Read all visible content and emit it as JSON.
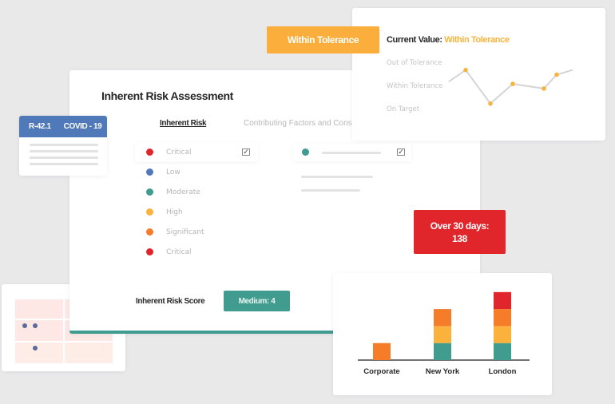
{
  "main": {
    "title": "Inherent Risk Assessment",
    "tabs": [
      {
        "label": "Inherent Risk",
        "active": true
      },
      {
        "label": "Contributing Factors and Cons",
        "active": false
      }
    ],
    "risk_levels": [
      {
        "label": "Critical",
        "color": "#e0262a",
        "checked": true
      },
      {
        "label": "Low",
        "color": "#4f79b8",
        "checked": false
      },
      {
        "label": "Moderate",
        "color": "#3f9c8f",
        "checked": false
      },
      {
        "label": "High",
        "color": "#fbb23c",
        "checked": false
      },
      {
        "label": "Significant",
        "color": "#f57c28",
        "checked": false
      },
      {
        "label": "Critical",
        "color": "#e0262a",
        "checked": false
      }
    ],
    "check_glyph": "✓",
    "score_label": "Inherent Risk Score",
    "score_value": "Medium: 4"
  },
  "covid_tag": {
    "id": "R-42.1",
    "name": "COVID - 19"
  },
  "tolerance_badge": "Within Tolerance",
  "tolerance_chart": {
    "title_prefix": "Current Value:",
    "title_value": "Within Tolerance",
    "levels": [
      "Out of Tolerance",
      "Within Tolerance",
      "On Target"
    ],
    "accent_color": "#f7b33c",
    "line_color": "#d5d5d5"
  },
  "overdue_badge": {
    "line1": "Over 30 days:",
    "line2": "138"
  },
  "chart_data": {
    "type": "bar",
    "stacked": true,
    "categories": [
      "Corporate",
      "New York",
      "London"
    ],
    "series": [
      {
        "name": "Moderate",
        "color": "#3f9c8f",
        "values": [
          0,
          1,
          1
        ]
      },
      {
        "name": "High",
        "color": "#fbb23c",
        "values": [
          0,
          1,
          1
        ]
      },
      {
        "name": "Significant",
        "color": "#f57c28",
        "values": [
          1,
          1,
          1
        ]
      },
      {
        "name": "Critical",
        "color": "#e0262a",
        "values": [
          0,
          0,
          1
        ]
      }
    ],
    "ylim": [
      0,
      4
    ],
    "grid": false,
    "legend": "none"
  },
  "tolerance_series": {
    "type": "line",
    "y_levels": [
      "On Target",
      "Within Tolerance",
      "Out of Tolerance"
    ],
    "values": [
      1.2,
      1.7,
      0.25,
      1.1,
      0.9,
      1.5,
      1.7
    ],
    "markers": [
      false,
      true,
      true,
      true,
      true,
      true,
      false
    ]
  },
  "risk_matrix": {
    "rows": 3,
    "cols": 2,
    "row_colors": [
      "#fde8e6",
      "#fde8e6",
      "#fdede6"
    ],
    "dot_color": "#5b6b9a",
    "dots": [
      [
        1,
        0
      ],
      [
        1,
        0
      ],
      [
        2,
        0
      ]
    ]
  }
}
